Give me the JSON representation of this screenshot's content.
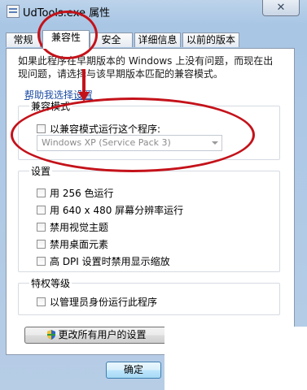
{
  "window": {
    "title": "UdTools.exe 属性",
    "close_glyph": "✕"
  },
  "tabs": [
    {
      "label": "常规"
    },
    {
      "label": "兼容性"
    },
    {
      "label": "安全"
    },
    {
      "label": "详细信息"
    },
    {
      "label": "以前的版本"
    }
  ],
  "intro_text": "如果此程序在早期版本的 Windows 上没有问题，而现在出现问题，请选择与该早期版本匹配的兼容模式。",
  "help_link": "帮助我选择设置",
  "compat_mode": {
    "title": "兼容模式",
    "checkbox_label": "以兼容模式运行这个程序:",
    "select_value": "Windows XP (Service Pack 3)"
  },
  "settings": {
    "title": "设置",
    "items": [
      {
        "label": "用 256 色运行"
      },
      {
        "label": "用 640 x 480 屏幕分辨率运行"
      },
      {
        "label": "禁用视觉主题"
      },
      {
        "label": "禁用桌面元素"
      },
      {
        "label": "高 DPI 设置时禁用显示缩放"
      }
    ]
  },
  "privilege": {
    "title": "特权等级",
    "checkbox_label": "以管理员身份运行此程序"
  },
  "buttons": {
    "change_all_users": "更改所有用户的设置",
    "ok": "确定"
  },
  "colors": {
    "annotation_red": "#c4121a",
    "link_blue": "#1c4ca3"
  }
}
